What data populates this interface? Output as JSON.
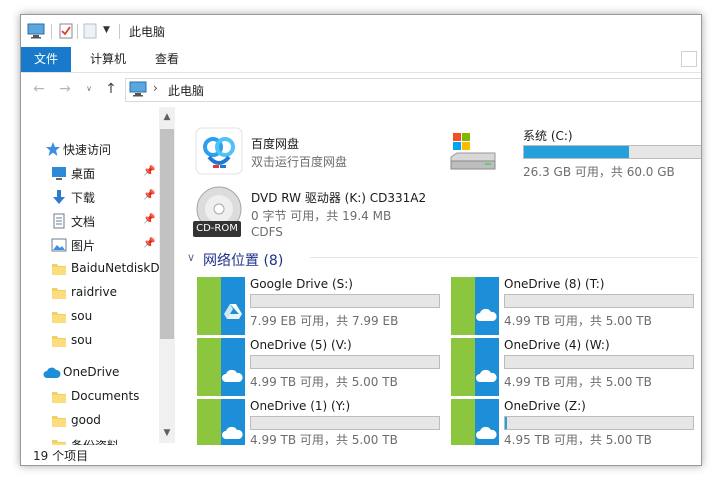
{
  "window": {
    "title": "此电脑"
  },
  "ribbon": {
    "tabs": [
      "文件",
      "计算机",
      "查看"
    ]
  },
  "address": {
    "path": "此电脑"
  },
  "sidebar": {
    "items": [
      {
        "label": "快速访问",
        "icon": "star-icon",
        "pinned": false
      },
      {
        "label": "桌面",
        "icon": "desktop-icon",
        "pinned": true
      },
      {
        "label": "下载",
        "icon": "download-icon",
        "pinned": true
      },
      {
        "label": "文档",
        "icon": "document-icon",
        "pinned": true
      },
      {
        "label": "图片",
        "icon": "picture-icon",
        "pinned": true
      },
      {
        "label": "BaiduNetdiskD",
        "icon": "folder-icon",
        "pinned": false
      },
      {
        "label": "raidrive",
        "icon": "folder-icon",
        "pinned": false
      },
      {
        "label": "sou",
        "icon": "folder-icon",
        "pinned": false
      },
      {
        "label": "sou",
        "icon": "folder-icon",
        "pinned": false
      },
      {
        "label": "OneDrive",
        "icon": "cloud-icon",
        "pinned": false
      },
      {
        "label": "Documents",
        "icon": "folder-icon",
        "pinned": false
      },
      {
        "label": "good",
        "icon": "folder-icon",
        "pinned": false
      },
      {
        "label": "备份资料",
        "icon": "folder-icon",
        "pinned": false
      }
    ]
  },
  "content": {
    "baidu": {
      "name": "百度网盘",
      "subtitle": "双击运行百度网盘"
    },
    "system": {
      "name": "系统 (C:)",
      "space": "26.3 GB 可用，共 60.0 GB",
      "used_fraction": 0.56
    },
    "dvd": {
      "name": "DVD RW 驱动器 (K:) CD331A2",
      "space": "0 字节 可用，共 19.4 MB",
      "fs": "CDFS",
      "badge": "CD-ROM"
    },
    "network_group": {
      "title": "网络位置 (8)"
    },
    "network": [
      {
        "name": "Google Drive (S:)",
        "space": "7.99 EB 可用，共 7.99 EB",
        "used_fraction": 0.0,
        "icon": "google-drive-icon"
      },
      {
        "name": "OneDrive (8) (T:)",
        "space": "4.99 TB 可用，共 5.00 TB",
        "used_fraction": 0.0,
        "icon": "onedrive-icon"
      },
      {
        "name": "OneDrive (5) (V:)",
        "space": "4.99 TB 可用，共 5.00 TB",
        "used_fraction": 0.0,
        "icon": "onedrive-icon"
      },
      {
        "name": "OneDrive (4) (W:)",
        "space": "4.99 TB 可用，共 5.00 TB",
        "used_fraction": 0.0,
        "icon": "onedrive-icon"
      },
      {
        "name": "OneDrive (1) (Y:)",
        "space": "4.99 TB 可用，共 5.00 TB",
        "used_fraction": 0.0,
        "icon": "onedrive-icon"
      },
      {
        "name": "OneDrive (Z:)",
        "space": "4.95 TB 可用，共 5.00 TB",
        "used_fraction": 0.01,
        "icon": "onedrive-icon"
      }
    ]
  },
  "status": {
    "count": "19 个项目"
  },
  "colors": {
    "accent": "#1979ca",
    "bar_fill": "#26a0da",
    "network_green": "#8cc63e",
    "network_blue": "#1d8ed8"
  }
}
